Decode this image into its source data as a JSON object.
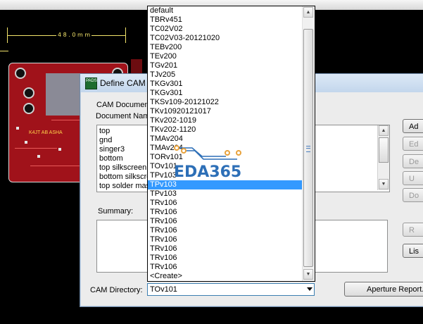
{
  "pcb": {
    "dimension_label": "4 8 . 0 m m",
    "silkscreen_mark": "K4JT AB ASHA"
  },
  "dialog": {
    "title": "Define CAM",
    "group_label": "CAM Documen",
    "documents_label": "Document Nam",
    "documents": [
      "top",
      "gnd",
      "singer3",
      "bottom",
      "top silkscreen",
      "bottom silkscre",
      "top solder mas"
    ],
    "summary_label": "Summary:",
    "cam_directory_label": "CAM Directory:",
    "cam_directory_value": "TOv101",
    "aperture_button": "Aperture Report...",
    "side_buttons": [
      "Ad",
      "Ed",
      "De",
      "U",
      "Do",
      "R",
      "Lis"
    ]
  },
  "dropdown": {
    "items": [
      "default",
      "TBRv451",
      "TC02V02",
      "TC02V03-20121020",
      "TEBv200",
      "TEv200",
      "TGv201",
      "TJv205",
      "TKGv301",
      "TKGv301",
      "TKSv109-20121022",
      "TKv10920121017",
      "TKv202-1019",
      "TKv202-1120",
      "TMAv204",
      "TMAv204",
      "TORv101",
      "TOv101",
      "TPv103",
      "TPv103",
      "TPv103",
      "TRv106",
      "TRv106",
      "TRv106",
      "TRv106",
      "TRv106",
      "TRv106",
      "TRv106",
      "TRv106",
      "<Create>"
    ],
    "selected_index": 19
  },
  "watermark": {
    "text": "EDA365",
    "color": "#2d6fb7"
  }
}
